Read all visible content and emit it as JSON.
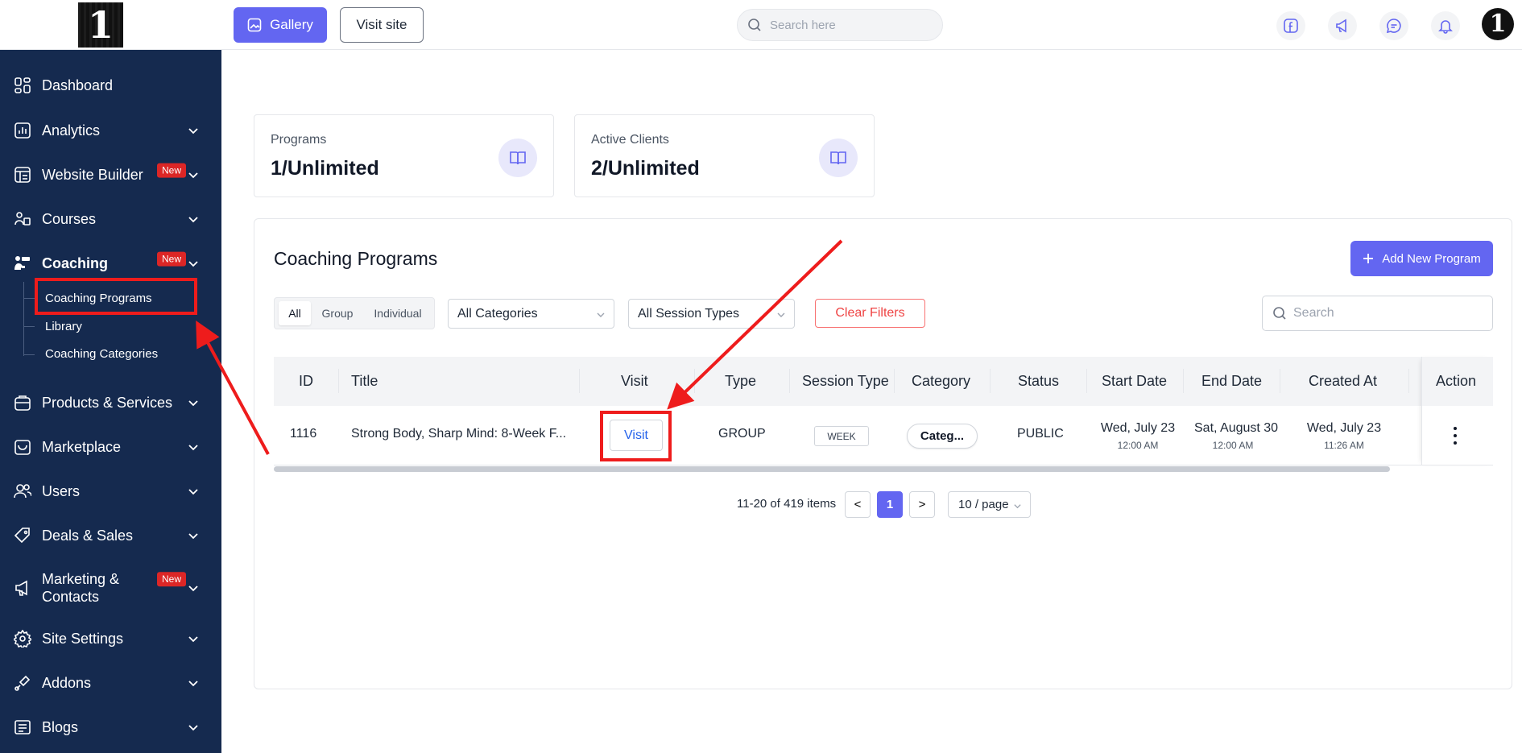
{
  "header": {
    "gallery_label": "Gallery",
    "visit_site_label": "Visit site",
    "search_placeholder": "Search here",
    "icons": [
      "facebook-icon",
      "megaphone-icon",
      "chat-icon",
      "bell-icon"
    ]
  },
  "sidebar": {
    "items": [
      {
        "label": "Dashboard",
        "icon": "dashboard-icon"
      },
      {
        "label": "Analytics",
        "icon": "analytics-icon"
      },
      {
        "label": "Website Builder",
        "icon": "website-builder-icon",
        "badge": "New"
      },
      {
        "label": "Courses",
        "icon": "courses-icon"
      },
      {
        "label": "Coaching",
        "icon": "coaching-icon",
        "badge": "New",
        "active": true
      },
      {
        "label": "Products & Services",
        "icon": "products-icon"
      },
      {
        "label": "Marketplace",
        "icon": "marketplace-icon"
      },
      {
        "label": "Users",
        "icon": "users-icon"
      },
      {
        "label": "Deals & Sales",
        "icon": "tag-icon"
      },
      {
        "label": "Marketing & Contacts",
        "icon": "megaphone-icon",
        "badge": "New"
      },
      {
        "label": "Site Settings",
        "icon": "gear-icon"
      },
      {
        "label": "Addons",
        "icon": "addons-icon"
      },
      {
        "label": "Blogs",
        "icon": "blogs-icon"
      }
    ],
    "coaching_sub": [
      "Coaching Programs",
      "Library",
      "Coaching Categories"
    ]
  },
  "stats": [
    {
      "label": "Programs",
      "value": "1/Unlimited"
    },
    {
      "label": "Active Clients",
      "value": "2/Unlimited"
    }
  ],
  "panel": {
    "title": "Coaching Programs",
    "add_label": "Add New Program",
    "segments": [
      "All",
      "Group",
      "Individual"
    ],
    "active_segment": "All",
    "category_filter": "All Categories",
    "session_filter": "All Session Types",
    "clear_label": "Clear Filters",
    "search_placeholder": "Search"
  },
  "table": {
    "columns": [
      "ID",
      "Title",
      "Visit",
      "Type",
      "Session Type",
      "Category",
      "Status",
      "Start Date",
      "End Date",
      "Created At",
      "Action"
    ],
    "rows": [
      {
        "id": "1116",
        "title": "Strong Body, Sharp Mind: 8-Week F...",
        "visit": "Visit",
        "type": "GROUP",
        "session_type": "WEEK",
        "category": "Categ...",
        "status": "PUBLIC",
        "start_date": "Wed, July 23",
        "start_time": "12:00 AM",
        "end_date": "Sat, August 30",
        "end_time": "12:00 AM",
        "created_date": "Wed, July 23",
        "created_time": "11:26 AM"
      }
    ]
  },
  "pagination": {
    "range": "11-20 of 419 items",
    "prev": "<",
    "current": "1",
    "next": ">",
    "page_size": "10 / page"
  },
  "colors": {
    "sidebar_bg": "#152a4f",
    "accent": "#6366f1",
    "danger": "#ef4444",
    "annotation": "#ee1c1c"
  }
}
